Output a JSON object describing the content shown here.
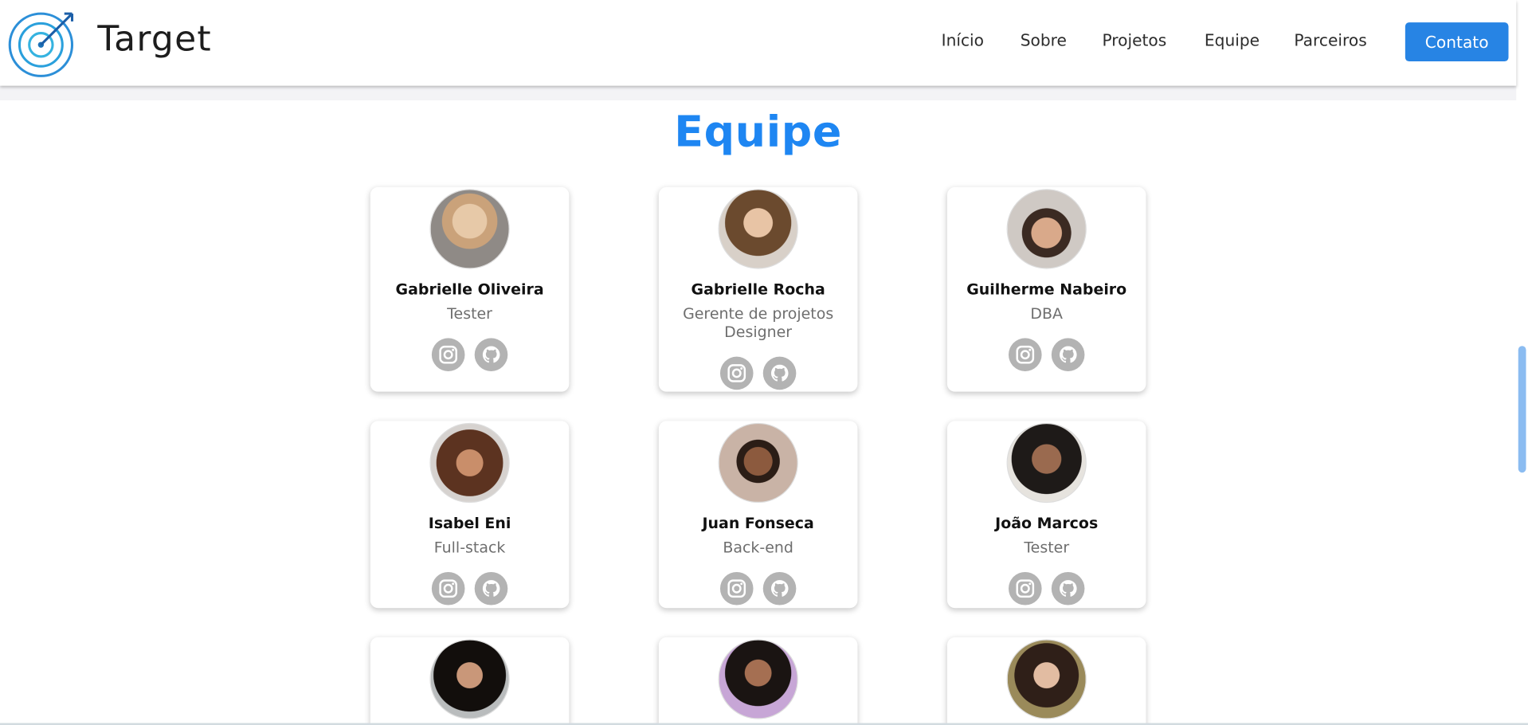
{
  "brand": {
    "name": "Target"
  },
  "nav": [
    {
      "label": "Início"
    },
    {
      "label": "Sobre"
    },
    {
      "label": "Projetos"
    },
    {
      "label": "Equipe"
    },
    {
      "label": "Parceiros"
    }
  ],
  "cta": {
    "label": "Contato"
  },
  "section": {
    "title": "Equipe"
  },
  "team": [
    {
      "name": "Gabrielle Oliveira",
      "role": "Tester",
      "role2": ""
    },
    {
      "name": "Gabrielle Rocha",
      "role": "Gerente de projetos",
      "role2": "Designer"
    },
    {
      "name": "Guilherme Nabeiro",
      "role": "DBA",
      "role2": ""
    },
    {
      "name": "Isabel Eni",
      "role": "Full-stack",
      "role2": ""
    },
    {
      "name": "Juan Fonseca",
      "role": "Back-end",
      "role2": ""
    },
    {
      "name": "João Marcos",
      "role": "Tester",
      "role2": ""
    }
  ],
  "colors": {
    "accent": "#2784e4",
    "title": "#1e86f2",
    "icon": "#b3b3b3"
  }
}
